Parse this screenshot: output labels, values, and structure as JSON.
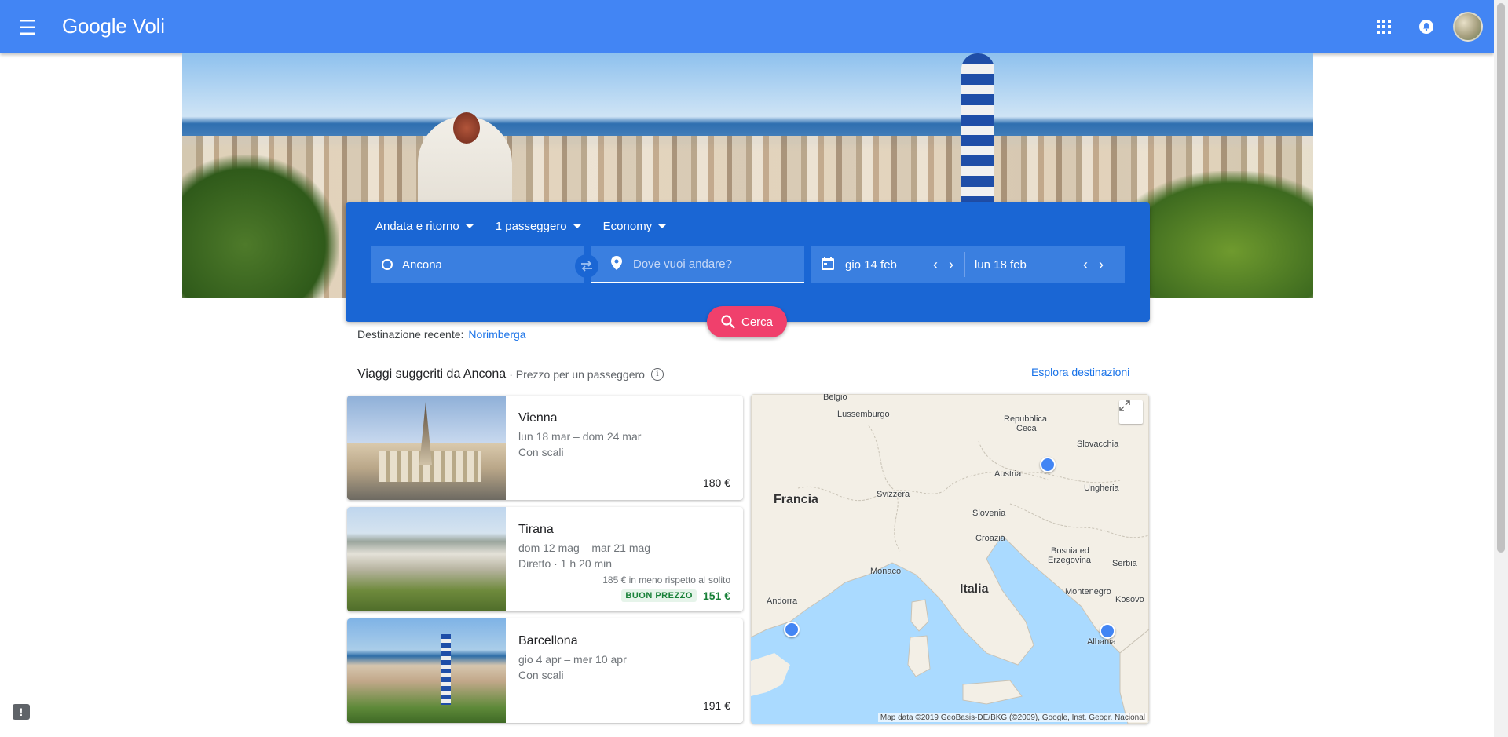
{
  "app": {
    "title": "Google Voli"
  },
  "search": {
    "trip_type": "Andata e ritorno",
    "passengers": "1 passeggero",
    "cabin": "Economy",
    "origin": "Ancona",
    "destination_placeholder": "Dove vuoi andare?",
    "depart_date": "gio 14 feb",
    "return_date": "lun 18 feb",
    "search_label": "Cerca"
  },
  "recent": {
    "label": "Destinazione recente:",
    "destination": "Norimberga"
  },
  "suggestions": {
    "title": "Viaggi suggeriti da Ancona",
    "subtitle": "· Prezzo per un passeggero",
    "explore_label": "Esplora destinazioni",
    "items": [
      {
        "city": "Vienna",
        "dates": "lun 18 mar – dom 24 mar",
        "stops": "Con scali",
        "price": "180 €"
      },
      {
        "city": "Tirana",
        "dates": "dom 12 mag – mar 21 mag",
        "stops": "Diretto · 1 h 20 min",
        "saving": "185 € in meno rispetto al solito",
        "badge": "BUON PREZZO",
        "price": "151 €"
      },
      {
        "city": "Barcellona",
        "dates": "gio 4 apr – mer 10 apr",
        "stops": "Con scali",
        "price": "191 €"
      }
    ]
  },
  "map": {
    "labels": [
      "Belgio",
      "Lussemburgo",
      "Repubblica",
      "Ceca",
      "Slovacchia",
      "Francia",
      "Austria",
      "Ungheria",
      "Svizzera",
      "Slovenia",
      "Croazia",
      "Bosnia ed",
      "Erzegovina",
      "Serbia",
      "Monaco",
      "Italia",
      "Montenegro",
      "Kosovo",
      "Andorra",
      "Albania"
    ],
    "attribution": "Map data ©2019 GeoBasis-DE/BKG (©2009), Google, Inst. Geogr. Nacional"
  },
  "colors": {
    "header": "#4285f4",
    "search_card": "#1a66d4",
    "cerca": "#f0406c",
    "link": "#1a73e8",
    "deal_green": "#188038",
    "map_water": "#aadaff",
    "map_land": "#f3efe6",
    "pin": "#4285f4"
  },
  "icons": [
    "menu-icon",
    "apps-icon",
    "notifications-icon",
    "swap-icon",
    "location-pin-icon",
    "calendar-icon",
    "search-icon",
    "info-icon",
    "expand-icon",
    "feedback-icon"
  ]
}
